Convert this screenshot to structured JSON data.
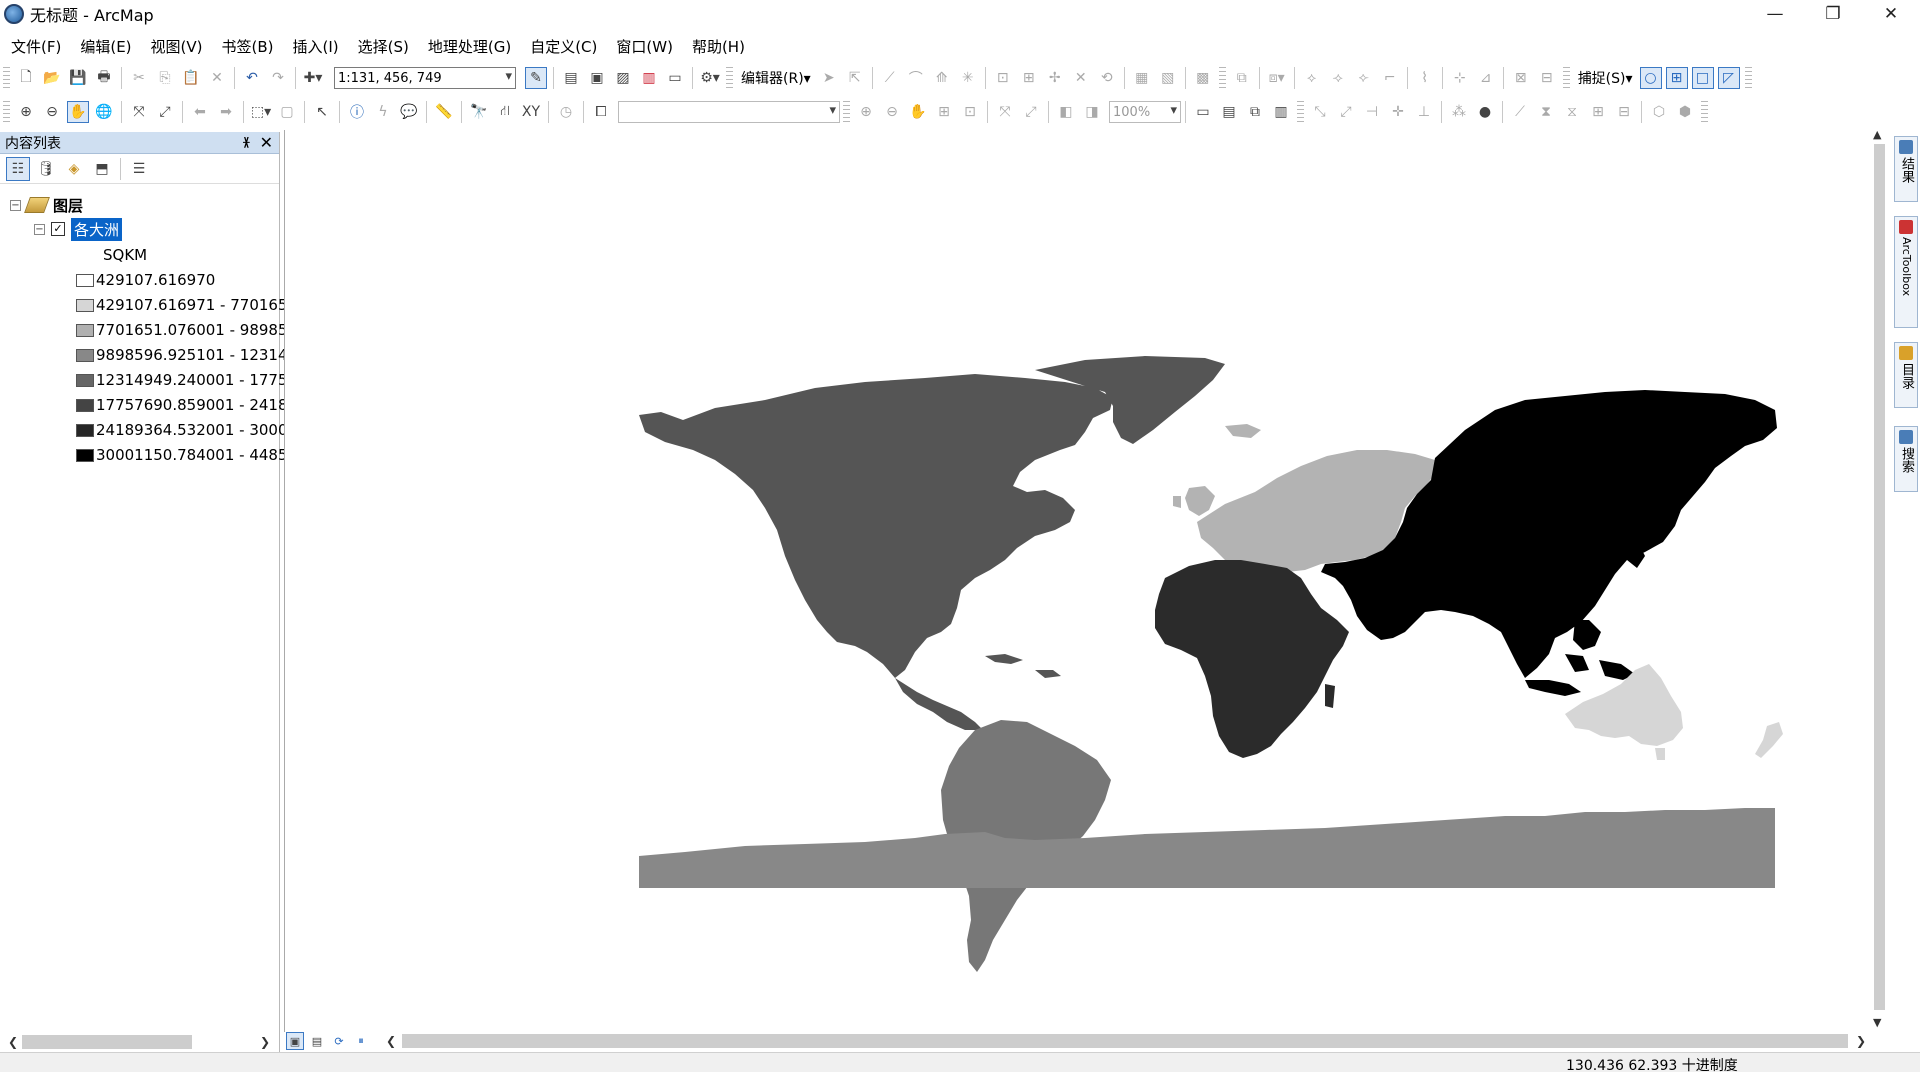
{
  "window": {
    "title": "无标题 - ArcMap",
    "buttons": [
      "—",
      "❐",
      "✕"
    ]
  },
  "menu": [
    "文件(F)",
    "编辑(E)",
    "视图(V)",
    "书签(B)",
    "插入(I)",
    "选择(S)",
    "地理处理(G)",
    "自定义(C)",
    "窗口(W)",
    "帮助(H)"
  ],
  "toolbar": {
    "scale": "1:131, 456, 749",
    "editor_label": "编辑器(R)▾",
    "snapping_label": "捕捉(S)▾",
    "zoom_level": "100%"
  },
  "toc": {
    "title": "内容列表",
    "root_label": "图层",
    "layer_name": "各大洲",
    "field_name": "SQKM",
    "legend": [
      {
        "label": "429107.616970",
        "color": "#ffffff"
      },
      {
        "label": "429107.616971 - 770165",
        "color": "#d6d6d6"
      },
      {
        "label": "7701651.076001 - 98985",
        "color": "#b0b0b0"
      },
      {
        "label": "9898596.925101 - 12314",
        "color": "#888888"
      },
      {
        "label": "12314949.240001 - 1775",
        "color": "#666666"
      },
      {
        "label": "17757690.859001 - 2418",
        "color": "#444444"
      },
      {
        "label": "24189364.532001 - 3000",
        "color": "#262626"
      },
      {
        "label": "30001150.784001 - 4485",
        "color": "#000000"
      }
    ]
  },
  "right_dock": [
    "结果",
    "ArcToolbox",
    "目录",
    "搜索"
  ],
  "status": {
    "coordinates": "130.436  62.393 十进制度"
  },
  "continents": {
    "north_america": "#555555",
    "south_america": "#777777",
    "europe": "#b3b3b3",
    "asia": "#000000",
    "africa": "#2b2b2b",
    "oceania": "#d6d6d6",
    "antarctica": "#888888"
  }
}
